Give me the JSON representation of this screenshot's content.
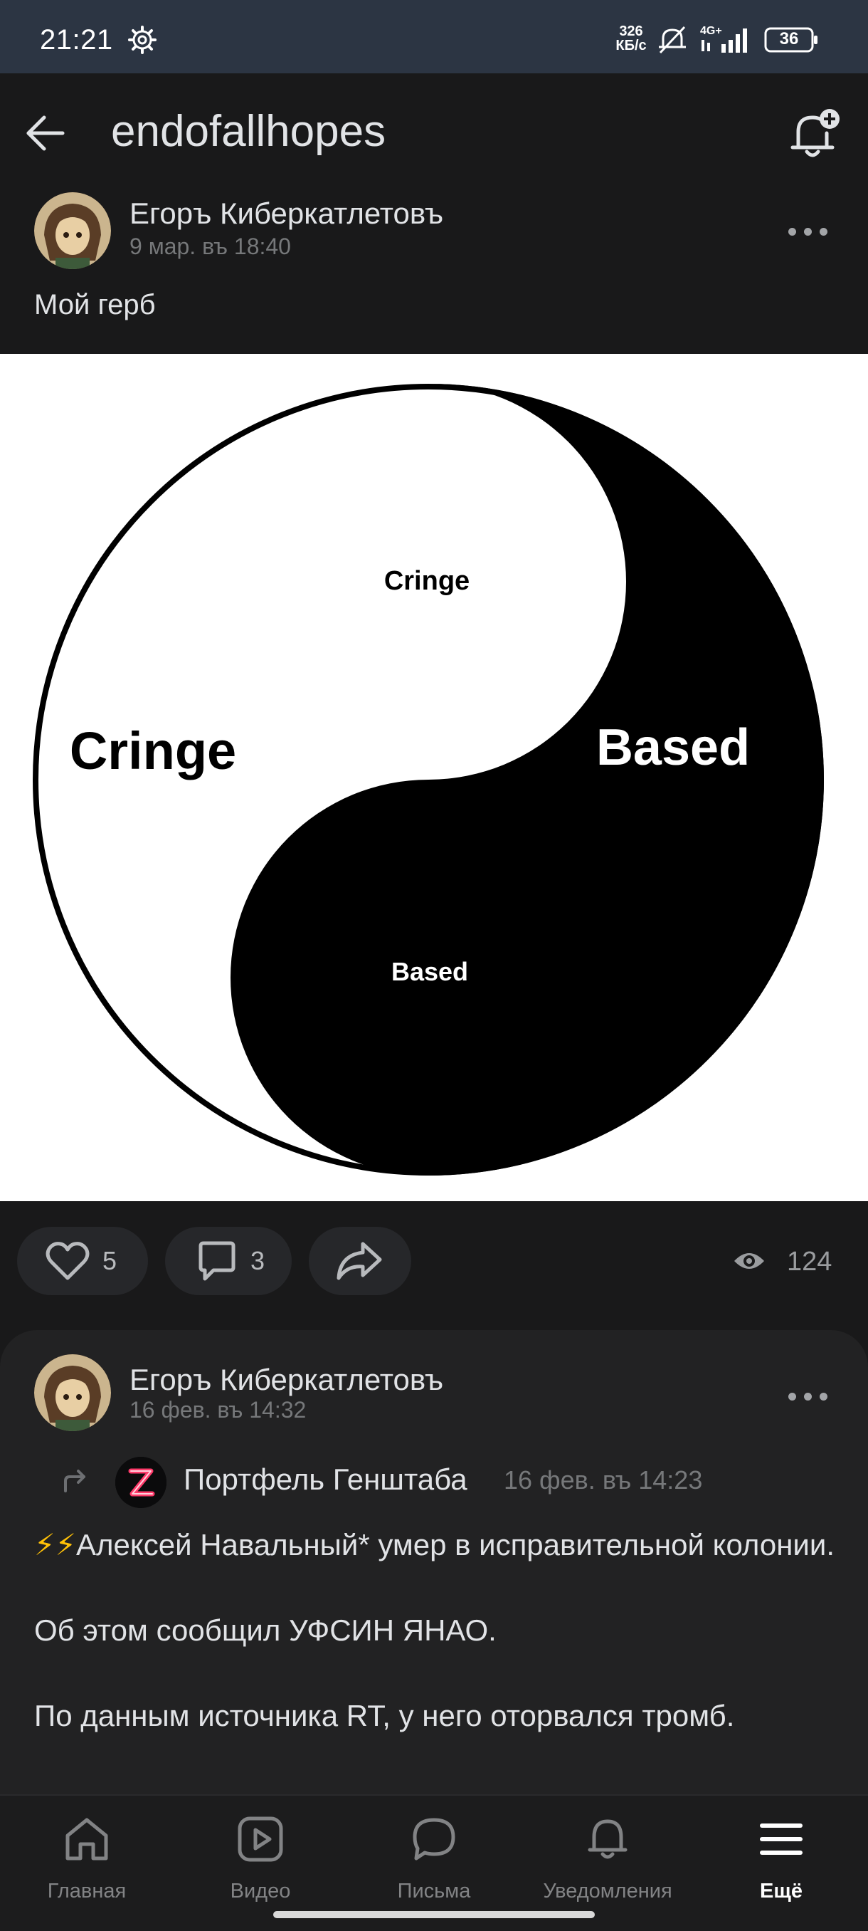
{
  "status_bar": {
    "time": "21:21",
    "net_speed_value": "326",
    "net_speed_unit": "КБ/с",
    "network": "4G+",
    "battery": "36"
  },
  "header": {
    "title": "endofallhopes"
  },
  "post1": {
    "author": "Егоръ Киберкатлетовъ",
    "date": "9 мар. въ 18:40",
    "text": "Мой герб",
    "image_labels": {
      "left_big": "Cringe",
      "right_big": "Based",
      "top_dot": "Cringe",
      "bottom_dot": "Based"
    },
    "likes": "5",
    "comments": "3",
    "views": "124"
  },
  "post2": {
    "author": "Егоръ Киберкатлетовъ",
    "date": "16 фев. въ 14:32",
    "repost_source": "Портфель Генштаба",
    "repost_date": "16 фев. въ 14:23",
    "emoji": "⚡⚡",
    "line1": "Алексей Навальный* умер в исправительной колонии.",
    "line2": "Об этом сообщил УФСИН ЯНАО.",
    "line3": "По данным источника RT, у него оторвался тромб."
  },
  "nav": {
    "items": [
      {
        "label": "Главная"
      },
      {
        "label": "Видео"
      },
      {
        "label": "Письма"
      },
      {
        "label": "Уведомления"
      },
      {
        "label": "Ещё"
      }
    ]
  },
  "colors": {
    "background": "#19191a",
    "status_bar": "#2c3543",
    "text_primary": "#e1e3e6",
    "text_secondary": "#76787a",
    "pill": "#26272a",
    "card": "#222223"
  }
}
